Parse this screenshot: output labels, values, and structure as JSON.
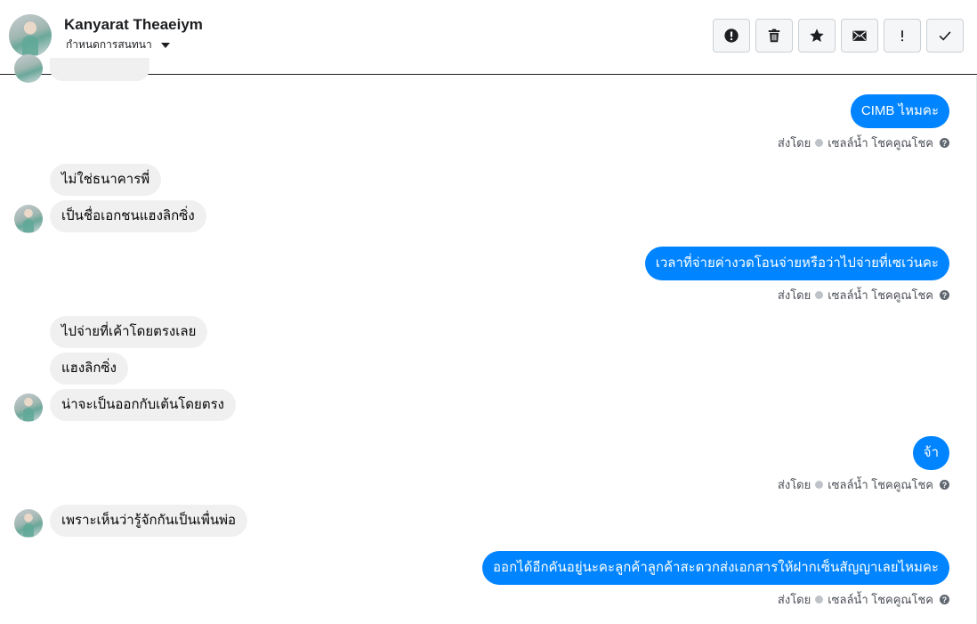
{
  "header": {
    "name": "Kanyarat Theaeiym",
    "subtitle": "กำหนดการสนทนา",
    "avatar_icon": "user-avatar",
    "toolbar": [
      {
        "name": "spam-alert-button",
        "icon": "exclamation-circle-icon",
        "glyph": "!"
      },
      {
        "name": "delete-button",
        "icon": "trash-icon",
        "glyph": ""
      },
      {
        "name": "star-button",
        "icon": "star-icon",
        "glyph": "★"
      },
      {
        "name": "mark-unread-button",
        "icon": "envelope-icon",
        "glyph": ""
      },
      {
        "name": "follow-up-button",
        "icon": "exclamation-icon",
        "glyph": "!"
      },
      {
        "name": "mark-done-button",
        "icon": "check-icon",
        "glyph": "✓"
      }
    ]
  },
  "messages": {
    "m1": "CIMB ไหมคะ",
    "m2": "ไม่ใช่ธนาคารพี่",
    "m3": "เป็นชื่อเอกชนแฮงลิกซิ่ง",
    "m4": "เวลาที่จ่ายค่างวดโอนจ่ายหรือว่าไปจ่ายที่เซเว่นคะ",
    "m5": "ไปจ่ายที่เค้าโดยตรงเลย",
    "m6": "แฮงลิกซิ่ง",
    "m7": "น่าจะเป็นออกกับเต้นโดยตรง",
    "m8": "จ้า",
    "m9": "เพราะเห็นว่ารู้จักกันเป็นเพื่นพ่อ",
    "m10": "ออกได้อีกคันอยู่นะคะลูกค้าลูกค้าสะดวกส่งเอกสารให้ฝากเซ็นสัญญาเลยไหมคะ"
  },
  "sent_meta": {
    "sent_by": "ส่งโดย",
    "sender": "เซลล์น้ำ โชคคูณโชค",
    "help_icon": "question-circle-icon"
  },
  "colors": {
    "outgoing_bubble": "#0084ff",
    "incoming_bubble": "#f0f0f0",
    "meta_text": "#4b4f56"
  }
}
